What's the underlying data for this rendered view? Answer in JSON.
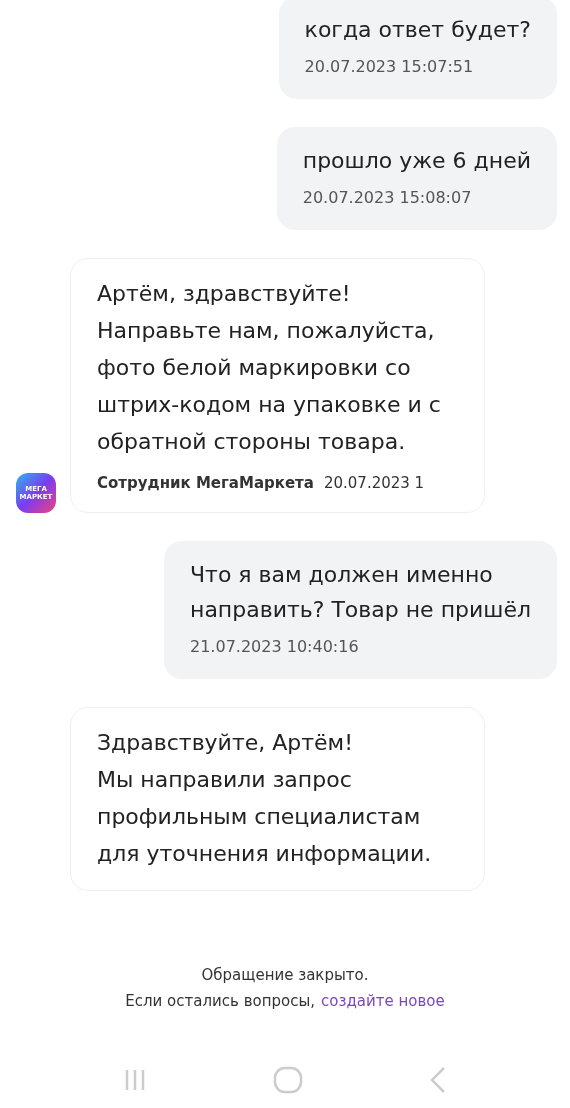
{
  "messages": [
    {
      "kind": "outgoing",
      "text": "когда ответ будет?",
      "time": "20.07.2023 15:07:51"
    },
    {
      "kind": "outgoing",
      "text": "прошло уже 6 дней",
      "time": "20.07.2023 15:08:07"
    },
    {
      "kind": "incoming",
      "text": "Артём, здравствуйте!\nНаправьте нам, пожалуйста,\nфото белой маркировки со\nштрих-кодом на упаковке и с\nобратной стороны товара.",
      "author": "Сотрудник МегаМаркета",
      "time": "20.07.2023 1",
      "avatar": "МЕГА МАРКЕТ"
    },
    {
      "kind": "outgoing",
      "text": "Что я вам должен именно\nнаправить? Товар не пришёл",
      "time": "21.07.2023 10:40:16"
    },
    {
      "kind": "incoming",
      "text": "Здравствуйте, Артём!\nМы направили запрос\nпрофильным специалистам\nдля уточнения информации."
    }
  ],
  "notice": {
    "line_1": "Обращение закрыто.",
    "line_2": "Если остались вопросы,",
    "link": "создайте новое"
  }
}
